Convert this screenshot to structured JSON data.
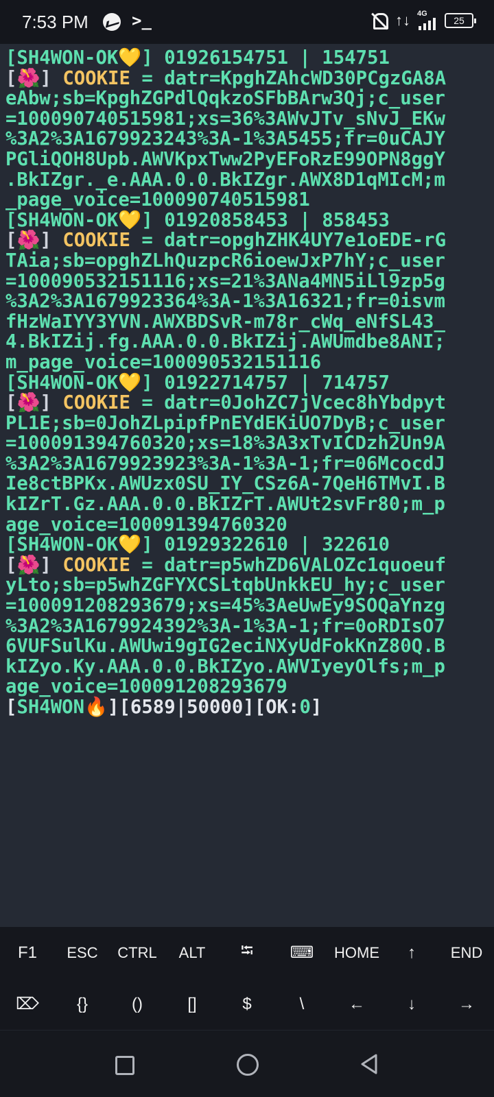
{
  "status_bar": {
    "time": "7:53 PM",
    "terminal_icon": ">_",
    "network": "4G",
    "battery": "25",
    "data_arrows": "↑↓"
  },
  "terminal": {
    "lines": [
      [
        {
          "t": "[SH4WON-OK",
          "c": "c-head"
        },
        {
          "t": "💛",
          "c": "c-head"
        },
        {
          "t": "] 01926154751 | 154751",
          "c": "c-head"
        }
      ],
      [
        {
          "t": "[",
          "c": "c-bracket"
        },
        {
          "t": "🌺",
          "c": "c-head"
        },
        {
          "t": "] ",
          "c": "c-bracket"
        },
        {
          "t": "COOKIE",
          "c": "c-yellow"
        },
        {
          "t": " = datr=KpghZAhcWD30PCgzGA8A",
          "c": "c-green"
        }
      ],
      [
        {
          "t": "eAbw;sb=KpghZGPdlQqkzoSFbBArw3Qj;c_user",
          "c": "c-green"
        }
      ],
      [
        {
          "t": "=100090740515981;xs=36%3AWvJTv_sNvJ_EKw",
          "c": "c-green"
        }
      ],
      [
        {
          "t": "%3A2%3A1679923243%3A-1%3A5455;fr=0uCAJY",
          "c": "c-green"
        }
      ],
      [
        {
          "t": "PGliQOH8Upb.AWVKpxTww2PyEFoRzE99OPN8ggY",
          "c": "c-green"
        }
      ],
      [
        {
          "t": ".BkIZgr._e.AAA.0.0.BkIZgr.AWX8D1qMIcM;m",
          "c": "c-green"
        }
      ],
      [
        {
          "t": "_page_voice=100090740515981",
          "c": "c-green"
        }
      ],
      [
        {
          "t": "[SH4WON-OK",
          "c": "c-head"
        },
        {
          "t": "💛",
          "c": "c-head"
        },
        {
          "t": "] 01920858453 | 858453",
          "c": "c-head"
        }
      ],
      [
        {
          "t": "[",
          "c": "c-bracket"
        },
        {
          "t": "🌺",
          "c": "c-head"
        },
        {
          "t": "] ",
          "c": "c-bracket"
        },
        {
          "t": "COOKIE",
          "c": "c-yellow"
        },
        {
          "t": " = datr=opghZHK4UY7e1oEDE-rG",
          "c": "c-green"
        }
      ],
      [
        {
          "t": "TAia;sb=opghZLhQuzpcR6ioewJxP7hY;c_user",
          "c": "c-green"
        }
      ],
      [
        {
          "t": "=100090532151116;xs=21%3ANa4MN5iLl9zp5g",
          "c": "c-green"
        }
      ],
      [
        {
          "t": "%3A2%3A1679923364%3A-1%3A16321;fr=0isvm",
          "c": "c-green"
        }
      ],
      [
        {
          "t": "fHzWaIYY3YVN.AWXBDSvR-m78r_cWq_eNfSL43_",
          "c": "c-green"
        }
      ],
      [
        {
          "t": "4.BkIZij.fg.AAA.0.0.BkIZij.AWUmdbe8ANI;",
          "c": "c-green"
        }
      ],
      [
        {
          "t": "m_page_voice=100090532151116",
          "c": "c-green"
        }
      ],
      [
        {
          "t": "[SH4WON-OK",
          "c": "c-head"
        },
        {
          "t": "💛",
          "c": "c-head"
        },
        {
          "t": "] 01922714757 | 714757",
          "c": "c-head"
        }
      ],
      [
        {
          "t": "[",
          "c": "c-bracket"
        },
        {
          "t": "🌺",
          "c": "c-head"
        },
        {
          "t": "] ",
          "c": "c-bracket"
        },
        {
          "t": "COOKIE",
          "c": "c-yellow"
        },
        {
          "t": " = datr=0JohZC7jVcec8hYbdpyt",
          "c": "c-green"
        }
      ],
      [
        {
          "t": "PL1E;sb=0JohZLpipfPnEYdEKiUO7DyB;c_user",
          "c": "c-green"
        }
      ],
      [
        {
          "t": "=100091394760320;xs=18%3A3xTvICDzh2Un9A",
          "c": "c-green"
        }
      ],
      [
        {
          "t": "%3A2%3A1679923923%3A-1%3A-1;fr=06McocdJ",
          "c": "c-green"
        }
      ],
      [
        {
          "t": "Ie8ctBPKx.AWUzx0SU_IY_CSz6A-7QeH6TMvI.B",
          "c": "c-green"
        }
      ],
      [
        {
          "t": "kIZrT.Gz.AAA.0.0.BkIZrT.AWUt2svFr80;m_p",
          "c": "c-green"
        }
      ],
      [
        {
          "t": "age_voice=100091394760320",
          "c": "c-green"
        }
      ],
      [
        {
          "t": "[SH4WON-OK",
          "c": "c-head"
        },
        {
          "t": "💛",
          "c": "c-head"
        },
        {
          "t": "] 01929322610 | 322610",
          "c": "c-head"
        }
      ],
      [
        {
          "t": "[",
          "c": "c-bracket"
        },
        {
          "t": "🌺",
          "c": "c-head"
        },
        {
          "t": "] ",
          "c": "c-bracket"
        },
        {
          "t": "COOKIE",
          "c": "c-yellow"
        },
        {
          "t": " = datr=p5whZD6VALOZc1quoeuf",
          "c": "c-green"
        }
      ],
      [
        {
          "t": "yLto;sb=p5whZGFYXCSLtqbUnkkEU_hy;c_user",
          "c": "c-green"
        }
      ],
      [
        {
          "t": "=100091208293679;xs=45%3AeUwEy9SOQaYnzg",
          "c": "c-green"
        }
      ],
      [
        {
          "t": "%3A2%3A1679924392%3A-1%3A-1;fr=0oRDIsO7",
          "c": "c-green"
        }
      ],
      [
        {
          "t": "6VUFSulKu.AWUwi9gIG2eciNXyUdFokKnZ80Q.B",
          "c": "c-green"
        }
      ],
      [
        {
          "t": "kIZyo.Ky.AAA.0.0.BkIZyo.AWVIyeyOlfs;m_p",
          "c": "c-green"
        }
      ],
      [
        {
          "t": "age_voice=100091208293679",
          "c": "c-green"
        }
      ],
      [
        {
          "t": "[",
          "c": "c-white"
        },
        {
          "t": "SH4WON",
          "c": "c-green"
        },
        {
          "t": "🔥",
          "c": "c-green"
        },
        {
          "t": "][6589|50000][OK:",
          "c": "c-white"
        },
        {
          "t": "0",
          "c": "c-green"
        },
        {
          "t": "]",
          "c": "c-white"
        }
      ]
    ]
  },
  "extra_keys": {
    "row1": [
      {
        "name": "key-f1",
        "label": "F1"
      },
      {
        "name": "key-esc",
        "label": "ESC"
      },
      {
        "name": "key-ctrl",
        "label": "CTRL"
      },
      {
        "name": "key-alt",
        "label": "ALT"
      },
      {
        "name": "key-tab",
        "label": "⭾"
      },
      {
        "name": "key-keyboard-toggle",
        "label": "⌨"
      },
      {
        "name": "key-home",
        "label": "HOME"
      },
      {
        "name": "key-up",
        "label": "↑"
      },
      {
        "name": "key-end",
        "label": "END"
      }
    ],
    "row2": [
      {
        "name": "key-delete",
        "label": "⌦"
      },
      {
        "name": "key-braces",
        "label": "{}"
      },
      {
        "name": "key-parens",
        "label": "()"
      },
      {
        "name": "key-brackets",
        "label": "[]"
      },
      {
        "name": "key-dollar",
        "label": "$"
      },
      {
        "name": "key-backslash",
        "label": "\\"
      },
      {
        "name": "key-left",
        "label": "←"
      },
      {
        "name": "key-down",
        "label": "↓"
      },
      {
        "name": "key-right",
        "label": "→"
      }
    ]
  },
  "navigation": {
    "icons": [
      "recent-apps-icon",
      "home-icon",
      "back-icon"
    ]
  }
}
